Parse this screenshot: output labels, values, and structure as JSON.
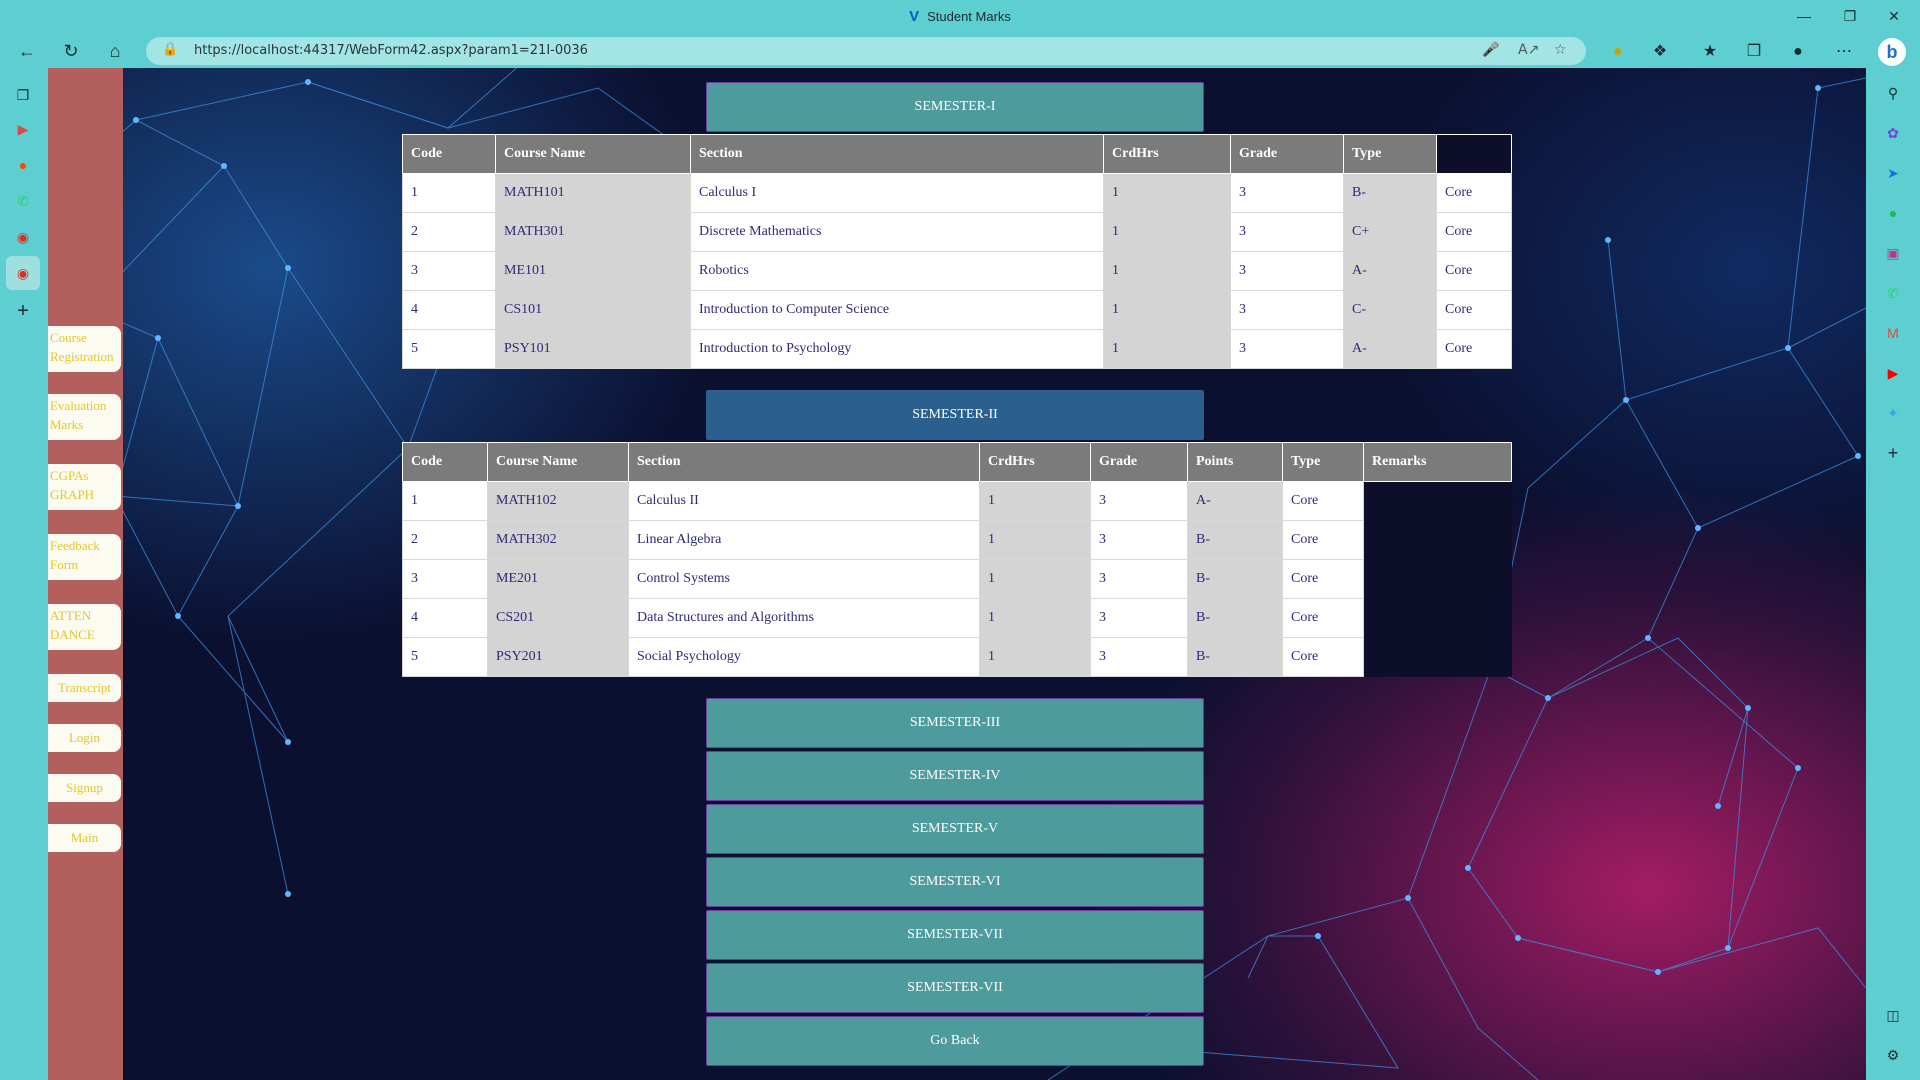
{
  "browser": {
    "title": "Student Marks",
    "url": "https://localhost:44317/WebForm42.aspx?param1=21I-0036"
  },
  "nav": {
    "course_registration": "Course Registration",
    "evaluation_marks": "Evaluation Marks",
    "cgpas_graph": "CGPAs GRAPH",
    "feedback_form": "Feedback Form",
    "attendance": "ATTEN DANCE",
    "transcript": "Transcript",
    "login": "Login",
    "signup": "Signup",
    "main": "Main"
  },
  "semester1": {
    "label": "SEMESTER-I",
    "headers": [
      "Code",
      "Course Name",
      "Section",
      "CrdHrs",
      "Grade",
      "Type"
    ],
    "rows": [
      [
        "1",
        "MATH101",
        "Calculus I",
        "1",
        "3",
        "B-",
        "Core"
      ],
      [
        "2",
        "MATH301",
        "Discrete Mathematics",
        "1",
        "3",
        "C+",
        "Core"
      ],
      [
        "3",
        "ME101",
        "Robotics",
        "1",
        "3",
        "A-",
        "Core"
      ],
      [
        "4",
        "CS101",
        "Introduction to Computer Science",
        "1",
        "3",
        "C-",
        "Core"
      ],
      [
        "5",
        "PSY101",
        "Introduction to Psychology",
        "1",
        "3",
        "A-",
        "Core"
      ]
    ]
  },
  "semester2": {
    "label": "SEMESTER-II",
    "headers": [
      "Code",
      "Course Name",
      "Section",
      "CrdHrs",
      "Grade",
      "Points",
      "Type",
      "Remarks"
    ],
    "rows": [
      [
        "1",
        "MATH102",
        "Calculus II",
        "1",
        "3",
        "A-",
        "Core"
      ],
      [
        "2",
        "MATH302",
        "Linear Algebra",
        "1",
        "3",
        "B-",
        "Core"
      ],
      [
        "3",
        "ME201",
        "Control Systems",
        "1",
        "3",
        "B-",
        "Core"
      ],
      [
        "4",
        "CS201",
        "Data Structures and Algorithms",
        "1",
        "3",
        "B-",
        "Core"
      ],
      [
        "5",
        "PSY201",
        "Social Psychology",
        "1",
        "3",
        "B-",
        "Core"
      ]
    ]
  },
  "semesters_more": [
    "SEMESTER-III",
    "SEMESTER-IV",
    "SEMESTER-V",
    "SEMESTER-VI",
    "SEMESTER-VII",
    "SEMESTER-VII"
  ],
  "go_back": "Go Back"
}
